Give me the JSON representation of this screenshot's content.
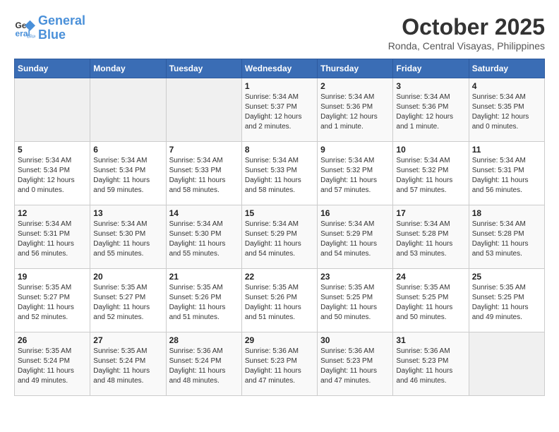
{
  "header": {
    "logo_line1": "General",
    "logo_line2": "Blue",
    "title": "October 2025",
    "subtitle": "Ronda, Central Visayas, Philippines"
  },
  "weekdays": [
    "Sunday",
    "Monday",
    "Tuesday",
    "Wednesday",
    "Thursday",
    "Friday",
    "Saturday"
  ],
  "weeks": [
    [
      {
        "day": "",
        "info": ""
      },
      {
        "day": "",
        "info": ""
      },
      {
        "day": "",
        "info": ""
      },
      {
        "day": "1",
        "info": "Sunrise: 5:34 AM\nSunset: 5:37 PM\nDaylight: 12 hours\nand 2 minutes."
      },
      {
        "day": "2",
        "info": "Sunrise: 5:34 AM\nSunset: 5:36 PM\nDaylight: 12 hours\nand 1 minute."
      },
      {
        "day": "3",
        "info": "Sunrise: 5:34 AM\nSunset: 5:36 PM\nDaylight: 12 hours\nand 1 minute."
      },
      {
        "day": "4",
        "info": "Sunrise: 5:34 AM\nSunset: 5:35 PM\nDaylight: 12 hours\nand 0 minutes."
      }
    ],
    [
      {
        "day": "5",
        "info": "Sunrise: 5:34 AM\nSunset: 5:34 PM\nDaylight: 12 hours\nand 0 minutes."
      },
      {
        "day": "6",
        "info": "Sunrise: 5:34 AM\nSunset: 5:34 PM\nDaylight: 11 hours\nand 59 minutes."
      },
      {
        "day": "7",
        "info": "Sunrise: 5:34 AM\nSunset: 5:33 PM\nDaylight: 11 hours\nand 58 minutes."
      },
      {
        "day": "8",
        "info": "Sunrise: 5:34 AM\nSunset: 5:33 PM\nDaylight: 11 hours\nand 58 minutes."
      },
      {
        "day": "9",
        "info": "Sunrise: 5:34 AM\nSunset: 5:32 PM\nDaylight: 11 hours\nand 57 minutes."
      },
      {
        "day": "10",
        "info": "Sunrise: 5:34 AM\nSunset: 5:32 PM\nDaylight: 11 hours\nand 57 minutes."
      },
      {
        "day": "11",
        "info": "Sunrise: 5:34 AM\nSunset: 5:31 PM\nDaylight: 11 hours\nand 56 minutes."
      }
    ],
    [
      {
        "day": "12",
        "info": "Sunrise: 5:34 AM\nSunset: 5:31 PM\nDaylight: 11 hours\nand 56 minutes."
      },
      {
        "day": "13",
        "info": "Sunrise: 5:34 AM\nSunset: 5:30 PM\nDaylight: 11 hours\nand 55 minutes."
      },
      {
        "day": "14",
        "info": "Sunrise: 5:34 AM\nSunset: 5:30 PM\nDaylight: 11 hours\nand 55 minutes."
      },
      {
        "day": "15",
        "info": "Sunrise: 5:34 AM\nSunset: 5:29 PM\nDaylight: 11 hours\nand 54 minutes."
      },
      {
        "day": "16",
        "info": "Sunrise: 5:34 AM\nSunset: 5:29 PM\nDaylight: 11 hours\nand 54 minutes."
      },
      {
        "day": "17",
        "info": "Sunrise: 5:34 AM\nSunset: 5:28 PM\nDaylight: 11 hours\nand 53 minutes."
      },
      {
        "day": "18",
        "info": "Sunrise: 5:34 AM\nSunset: 5:28 PM\nDaylight: 11 hours\nand 53 minutes."
      }
    ],
    [
      {
        "day": "19",
        "info": "Sunrise: 5:35 AM\nSunset: 5:27 PM\nDaylight: 11 hours\nand 52 minutes."
      },
      {
        "day": "20",
        "info": "Sunrise: 5:35 AM\nSunset: 5:27 PM\nDaylight: 11 hours\nand 52 minutes."
      },
      {
        "day": "21",
        "info": "Sunrise: 5:35 AM\nSunset: 5:26 PM\nDaylight: 11 hours\nand 51 minutes."
      },
      {
        "day": "22",
        "info": "Sunrise: 5:35 AM\nSunset: 5:26 PM\nDaylight: 11 hours\nand 51 minutes."
      },
      {
        "day": "23",
        "info": "Sunrise: 5:35 AM\nSunset: 5:25 PM\nDaylight: 11 hours\nand 50 minutes."
      },
      {
        "day": "24",
        "info": "Sunrise: 5:35 AM\nSunset: 5:25 PM\nDaylight: 11 hours\nand 50 minutes."
      },
      {
        "day": "25",
        "info": "Sunrise: 5:35 AM\nSunset: 5:25 PM\nDaylight: 11 hours\nand 49 minutes."
      }
    ],
    [
      {
        "day": "26",
        "info": "Sunrise: 5:35 AM\nSunset: 5:24 PM\nDaylight: 11 hours\nand 49 minutes."
      },
      {
        "day": "27",
        "info": "Sunrise: 5:35 AM\nSunset: 5:24 PM\nDaylight: 11 hours\nand 48 minutes."
      },
      {
        "day": "28",
        "info": "Sunrise: 5:36 AM\nSunset: 5:24 PM\nDaylight: 11 hours\nand 48 minutes."
      },
      {
        "day": "29",
        "info": "Sunrise: 5:36 AM\nSunset: 5:23 PM\nDaylight: 11 hours\nand 47 minutes."
      },
      {
        "day": "30",
        "info": "Sunrise: 5:36 AM\nSunset: 5:23 PM\nDaylight: 11 hours\nand 47 minutes."
      },
      {
        "day": "31",
        "info": "Sunrise: 5:36 AM\nSunset: 5:23 PM\nDaylight: 11 hours\nand 46 minutes."
      },
      {
        "day": "",
        "info": ""
      }
    ]
  ]
}
